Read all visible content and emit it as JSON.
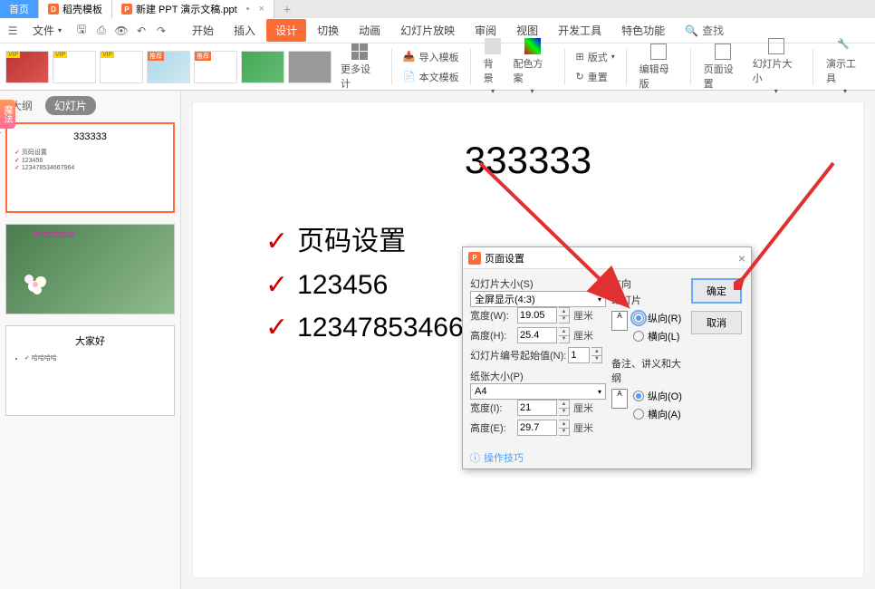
{
  "tabs": {
    "home": "首页",
    "template": "稻壳模板",
    "file": "新建 PPT 演示文稿.ppt",
    "add": "+"
  },
  "menu": {
    "file_menu": "文件",
    "items": [
      "开始",
      "插入",
      "设计",
      "切换",
      "动画",
      "幻灯片放映",
      "审阅",
      "视图",
      "开发工具",
      "特色功能"
    ],
    "active_index": 2,
    "search": "查找"
  },
  "ribbon": {
    "more_designs": "更多设计",
    "import_template": "导入模板",
    "this_template": "本文模板",
    "background": "背景",
    "color_scheme": "配色方案",
    "layout": "版式",
    "reset": "重置",
    "edit_master": "编辑母版",
    "page_setup": "页面设置",
    "slide_size": "幻灯片大小",
    "present_tools": "演示工具"
  },
  "sidebar": {
    "tab_outline": "大纲",
    "tab_slides": "幻灯片",
    "magic_ad": "魔法",
    "slide1": {
      "title": "333333",
      "items": [
        "页码设置",
        "123456",
        "12347853466796​4"
      ]
    },
    "slide2": {
      "overlay": "222222222"
    },
    "slide3": {
      "title": "大家好",
      "item": "哈哈哈哈"
    }
  },
  "canvas": {
    "title": "333333",
    "items": [
      "页码设置",
      "123456",
      "123478534667964"
    ]
  },
  "dialog": {
    "title": "页面设置",
    "slide_size_label": "幻灯片大小(S)",
    "slide_size_value": "全屏显示(4:3)",
    "width_label": "宽度(W):",
    "width_value": "19.05",
    "height_label": "高度(H):",
    "height_value": "25.4",
    "start_num_label": "幻灯片编号起始值(N):",
    "start_num_value": "1",
    "paper_size_label": "纸张大小(P)",
    "paper_size_value": "A4",
    "paper_width_label": "宽度(I):",
    "paper_width_value": "21",
    "paper_height_label": "高度(E):",
    "paper_height_value": "29.7",
    "unit": "厘米",
    "orientation_label": "方向",
    "slides_label": "幻灯片",
    "portrait_r": "纵向(R)",
    "landscape_l": "横向(L)",
    "notes_label": "备注、讲义和大纲",
    "portrait_o": "纵向(O)",
    "landscape_a": "横向(A)",
    "ok": "确定",
    "cancel": "取消",
    "help_link": "操作技巧"
  }
}
